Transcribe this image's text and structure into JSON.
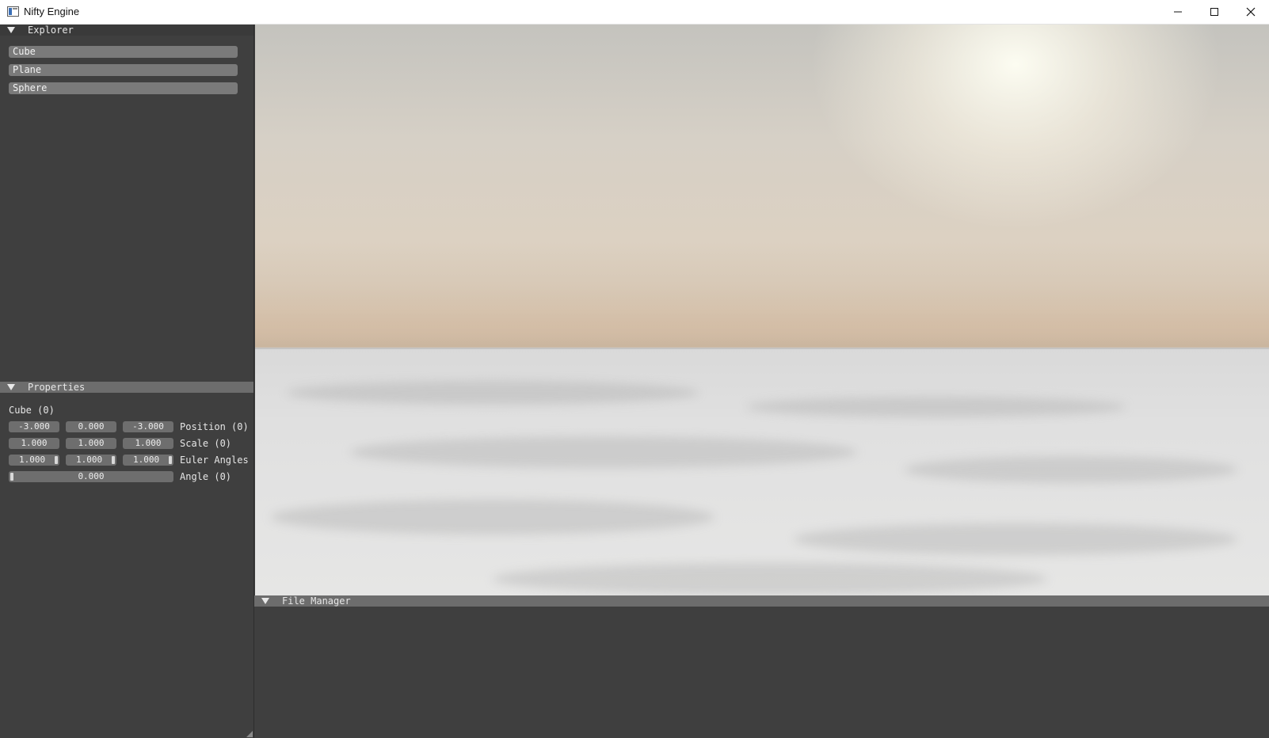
{
  "window": {
    "title": "Nifty Engine"
  },
  "explorer": {
    "title": "Explorer",
    "items": [
      {
        "label": "Cube"
      },
      {
        "label": "Plane"
      },
      {
        "label": "Sphere"
      }
    ]
  },
  "properties": {
    "title": "Properties",
    "object_name": "Cube (0)",
    "position": {
      "x": "-3.000",
      "y": "0.000",
      "z": "-3.000",
      "label": "Position (0)"
    },
    "scale": {
      "x": "1.000",
      "y": "1.000",
      "z": "1.000",
      "label": "Scale (0)"
    },
    "euler": {
      "x": "1.000",
      "y": "1.000",
      "z": "1.000",
      "label": "Euler Angles"
    },
    "angle": {
      "value": "0.000",
      "label": "Angle (0)"
    }
  },
  "file_manager": {
    "title": "File Manager"
  },
  "icons": {
    "app": "app-window-icon",
    "minimize": "minimize-icon",
    "maximize": "maximize-icon",
    "close": "close-icon",
    "collapse": "collapse-triangle-icon"
  }
}
